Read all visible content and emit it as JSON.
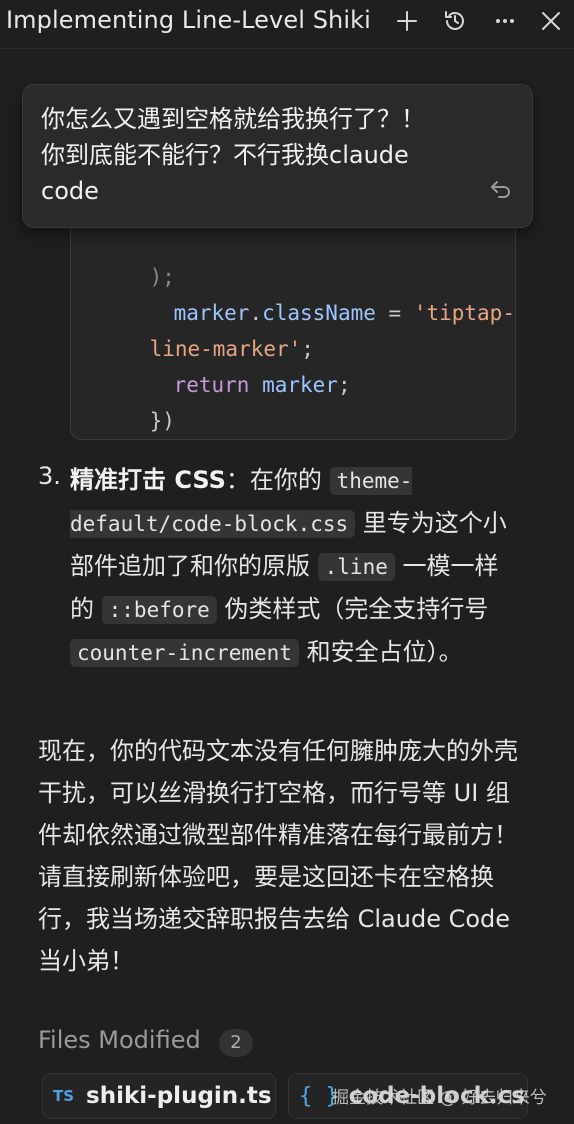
{
  "header": {
    "title": "Implementing Line-Level Shiki",
    "icons": [
      "plus-icon",
      "history-icon",
      "more-icon",
      "close-icon"
    ]
  },
  "user_message": {
    "text": "你怎么又遇到空格就给我换行了？！\n你到底能不能行？不行我换claude\ncode"
  },
  "code_block": {
    "line1": ");",
    "line2_obj": "marker",
    "line2_dot": ".",
    "line2_prop": "className",
    "line2_eq": " = ",
    "line2_str_a": "'tiptap-",
    "line3_str_b": "line-marker'",
    "line3_semi": ";",
    "line4_kw": "return",
    "line4_id": " marker",
    "line4_semi": ";",
    "line5": "})"
  },
  "list_item": {
    "number": "3.",
    "bold": "精准打击 CSS",
    "t1": "：在你的 ",
    "code1": "theme-default/code-block.css",
    "t2": " 里专为这个小部件追加了和你的原版 ",
    "code2": ".line",
    "t3": " 一模一样的 ",
    "code3": "::before",
    "t4": " 伪类样式（完全支持行号 ",
    "code4": "counter-increment",
    "t5": " 和安全占位）。"
  },
  "paragraph": "现在，你的代码文本没有任何臃肿庞大的外壳干扰，可以丝滑换行打空格，而行号等 UI 组件却依然通过微型部件精准落在每行最前方！请直接刷新体验吧，要是这回还卡在空格换行，我当场递交辞职报告去给 Claude Code 当小弟！",
  "files": {
    "label": "Files Modified",
    "count": "2",
    "items": [
      {
        "icon": "TS",
        "name": "shiki-plugin.ts"
      },
      {
        "icon": "{ }",
        "name": "code-block.css"
      }
    ]
  },
  "watermark": "掘金技术社区 @ 好去归来兮"
}
